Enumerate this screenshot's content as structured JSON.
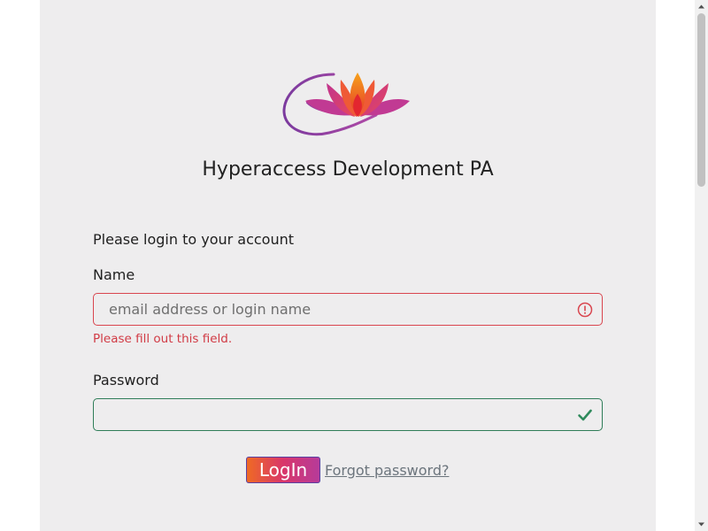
{
  "brand": {
    "site_title": "Hyperaccess Development PA",
    "logo_icon": "lotus-logo-icon"
  },
  "form": {
    "prompt": "Please login to your account",
    "name_label": "Name",
    "name_placeholder": "email address or login name",
    "name_value": "",
    "name_error": "Please fill out this field.",
    "name_status_icon": "exclamation-circle-icon",
    "password_label": "Password",
    "password_value": "",
    "password_status_icon": "check-icon",
    "login_label": "LogIn",
    "forgot_label": "Forgot password?"
  },
  "colors": {
    "panel_bg": "#eeedee",
    "error": "#d9464f",
    "valid": "#2f7d58",
    "button_gradient_start": "#ef6a24",
    "button_gradient_end": "#b63b9a",
    "link": "#6c757d"
  }
}
